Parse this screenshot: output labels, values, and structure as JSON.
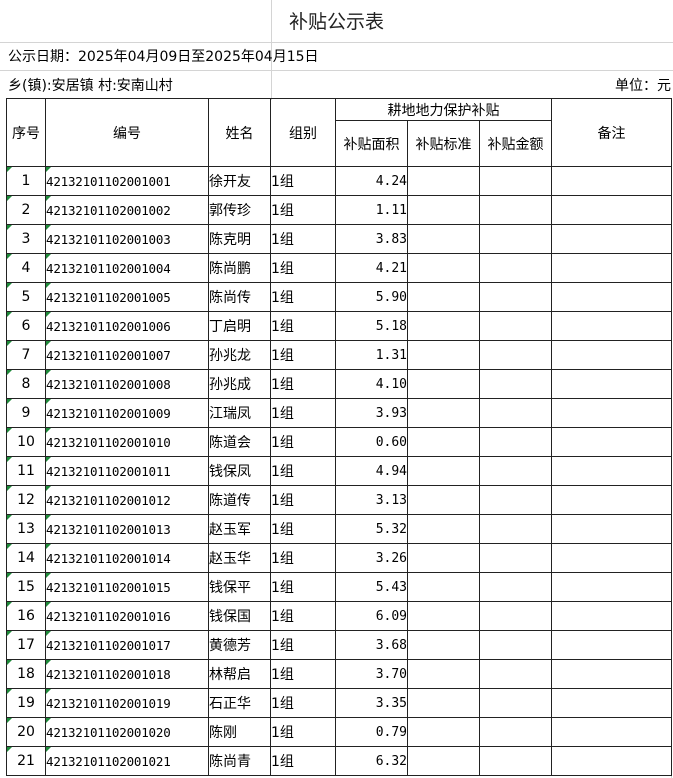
{
  "title": "补贴公示表",
  "date_line": "公示日期：2025年04月09日至2025年04月15日",
  "region_line": "乡(镇):安居镇 村:安南山村",
  "unit_line": "单位：元",
  "headers": {
    "index": "序号",
    "code": "编号",
    "name": "姓名",
    "group": "组别",
    "subsidy_group": "耕地地力保护补贴",
    "area": "补贴面积",
    "standard": "补贴标准",
    "amount": "补贴金额",
    "remark": "备注"
  },
  "rows": [
    {
      "index": "1",
      "code": "42132101102001001",
      "name": "徐开友",
      "group": "1组",
      "area": "4.24"
    },
    {
      "index": "2",
      "code": "42132101102001002",
      "name": "郭传珍",
      "group": "1组",
      "area": "1.11"
    },
    {
      "index": "3",
      "code": "42132101102001003",
      "name": "陈克明",
      "group": "1组",
      "area": "3.83"
    },
    {
      "index": "4",
      "code": "42132101102001004",
      "name": "陈尚鹏",
      "group": "1组",
      "area": "4.21"
    },
    {
      "index": "5",
      "code": "42132101102001005",
      "name": "陈尚传",
      "group": "1组",
      "area": "5.90"
    },
    {
      "index": "6",
      "code": "42132101102001006",
      "name": "丁启明",
      "group": "1组",
      "area": "5.18"
    },
    {
      "index": "7",
      "code": "42132101102001007",
      "name": "孙兆龙",
      "group": "1组",
      "area": "1.31"
    },
    {
      "index": "8",
      "code": "42132101102001008",
      "name": "孙兆成",
      "group": "1组",
      "area": "4.10"
    },
    {
      "index": "9",
      "code": "42132101102001009",
      "name": "江瑞凤",
      "group": "1组",
      "area": "3.93"
    },
    {
      "index": "10",
      "code": "42132101102001010",
      "name": "陈道会",
      "group": "1组",
      "area": "0.60"
    },
    {
      "index": "11",
      "code": "42132101102001011",
      "name": "钱保凤",
      "group": "1组",
      "area": "4.94"
    },
    {
      "index": "12",
      "code": "42132101102001012",
      "name": "陈道传",
      "group": "1组",
      "area": "3.13"
    },
    {
      "index": "13",
      "code": "42132101102001013",
      "name": "赵玉军",
      "group": "1组",
      "area": "5.32"
    },
    {
      "index": "14",
      "code": "42132101102001014",
      "name": "赵玉华",
      "group": "1组",
      "area": "3.26"
    },
    {
      "index": "15",
      "code": "42132101102001015",
      "name": "钱保平",
      "group": "1组",
      "area": "5.43"
    },
    {
      "index": "16",
      "code": "42132101102001016",
      "name": "钱保国",
      "group": "1组",
      "area": "6.09"
    },
    {
      "index": "17",
      "code": "42132101102001017",
      "name": "黄德芳",
      "group": "1组",
      "area": "3.68"
    },
    {
      "index": "18",
      "code": "42132101102001018",
      "name": "林帮启",
      "group": "1组",
      "area": "3.70"
    },
    {
      "index": "19",
      "code": "42132101102001019",
      "name": "石正华",
      "group": "1组",
      "area": "3.35"
    },
    {
      "index": "20",
      "code": "42132101102001020",
      "name": "陈刚",
      "group": "1组",
      "area": "0.79"
    },
    {
      "index": "21",
      "code": "42132101102001021",
      "name": "陈尚青",
      "group": "1组",
      "area": "6.32"
    }
  ],
  "colors": {
    "grid_line": "#222222",
    "light_line": "#d4d4d4",
    "marker": "#1e8a3a"
  }
}
